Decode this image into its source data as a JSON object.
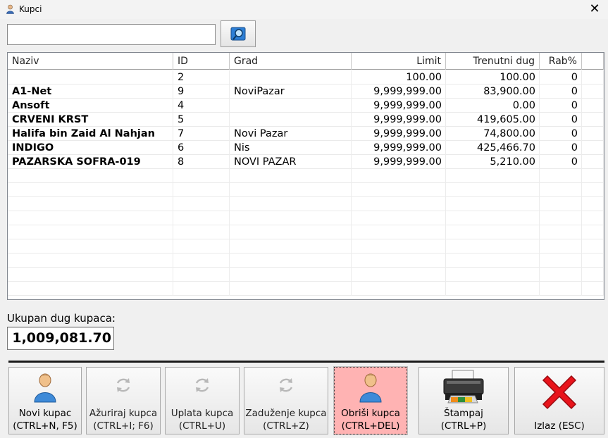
{
  "window": {
    "title": "Kupci",
    "close_glyph": "✕"
  },
  "search": {
    "value": "",
    "placeholder": ""
  },
  "grid": {
    "columns": [
      "Naziv",
      "ID",
      "Grad",
      "Limit",
      "Trenutni dug",
      "Rab%"
    ],
    "rows": [
      {
        "naziv": "",
        "id": "2",
        "grad": "",
        "limit": "100.00",
        "dug": "100.00",
        "rab": "0"
      },
      {
        "naziv": "A1-Net",
        "id": "9",
        "grad": "NoviPazar",
        "limit": "9,999,999.00",
        "dug": "83,900.00",
        "rab": "0"
      },
      {
        "naziv": "Ansoft",
        "id": "4",
        "grad": "",
        "limit": "9,999,999.00",
        "dug": "0.00",
        "rab": "0"
      },
      {
        "naziv": "CRVENI KRST",
        "id": "5",
        "grad": "",
        "limit": "9,999,999.00",
        "dug": "419,605.00",
        "rab": "0"
      },
      {
        "naziv": "Halifa bin Zaid Al Nahjan",
        "id": "7",
        "grad": "Novi Pazar",
        "limit": "9,999,999.00",
        "dug": "74,800.00",
        "rab": "0"
      },
      {
        "naziv": "INDIGO",
        "id": "6",
        "grad": "Nis",
        "limit": "9,999,999.00",
        "dug": "425,466.70",
        "rab": "0"
      },
      {
        "naziv": "PAZARSKA SOFRA-019",
        "id": "8",
        "grad": "NOVI PAZAR",
        "limit": "9,999,999.00",
        "dug": "5,210.00",
        "rab": "0"
      }
    ],
    "empty_rows": 9
  },
  "total": {
    "label": "Ukupan dug kupaca:",
    "value": "1,009,081.70"
  },
  "buttons": [
    {
      "line1": "Novi kupac",
      "line2": "(CTRL+N, F5)",
      "icon": "user-icon"
    },
    {
      "line1": "Ažuriraj kupca",
      "line2": "(CTRL+I; F6)",
      "icon": "refresh-icon"
    },
    {
      "line1": "Uplata kupca",
      "line2": "(CTRL+U)",
      "icon": "refresh-icon"
    },
    {
      "line1": "Zaduženje kupca",
      "line2": "(CTRL+Z)",
      "icon": "refresh-icon"
    },
    {
      "line1": "Obriši kupca",
      "line2": "(CTRL+DEL)",
      "icon": "user-icon"
    },
    {
      "line1": "Štampaj",
      "line2": "(CTRL+P)",
      "icon": "printer-icon"
    },
    {
      "line1": "Izlaz (ESC)",
      "line2": "",
      "icon": "red-x-icon"
    }
  ],
  "colors": {
    "active_button": "#ffb3b3",
    "exit_red": "#e8141b"
  }
}
